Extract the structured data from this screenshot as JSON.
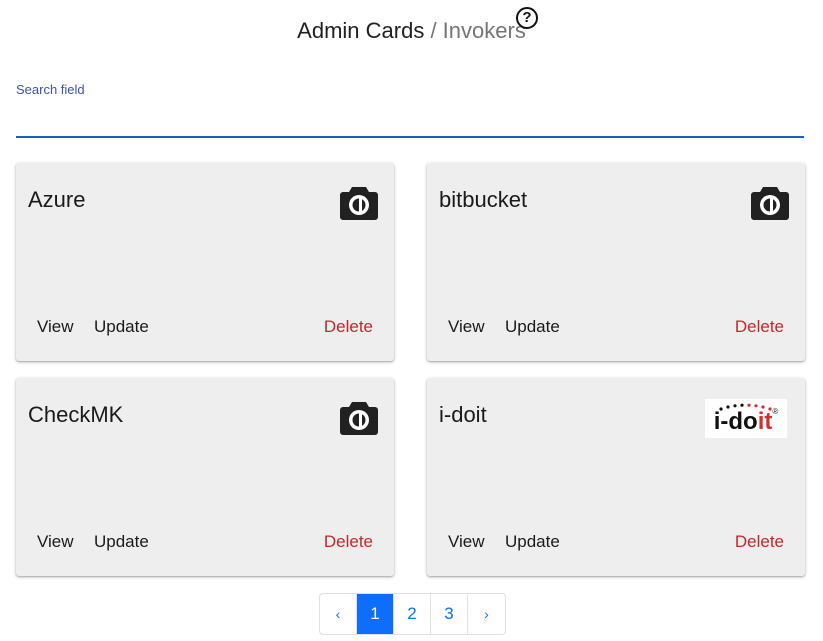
{
  "header": {
    "title": "Admin Cards",
    "separator": " / ",
    "subtitle": "Invokers",
    "help_glyph": "?"
  },
  "search": {
    "label": "Search field",
    "value": "",
    "placeholder": ""
  },
  "cards": [
    {
      "title": "Azure",
      "icon": "camera-icon",
      "view_label": "View",
      "update_label": "Update",
      "delete_label": "Delete"
    },
    {
      "title": "bitbucket",
      "icon": "camera-icon",
      "view_label": "View",
      "update_label": "Update",
      "delete_label": "Delete"
    },
    {
      "title": "CheckMK",
      "icon": "camera-icon",
      "view_label": "View",
      "update_label": "Update",
      "delete_label": "Delete"
    },
    {
      "title": "i-doit",
      "icon": "i-doit-logo",
      "logo_text_black": "i-do",
      "logo_text_red": "it",
      "logo_reg": "®",
      "view_label": "View",
      "update_label": "Update",
      "delete_label": "Delete"
    }
  ],
  "pagination": {
    "prev": "‹",
    "pages": [
      "1",
      "2",
      "3"
    ],
    "active_page": "1",
    "next": "›"
  },
  "colors": {
    "accent": "#0d6efd",
    "delete": "#c62828",
    "card_bg": "#eeeeee",
    "search_underline": "#1565c0"
  }
}
